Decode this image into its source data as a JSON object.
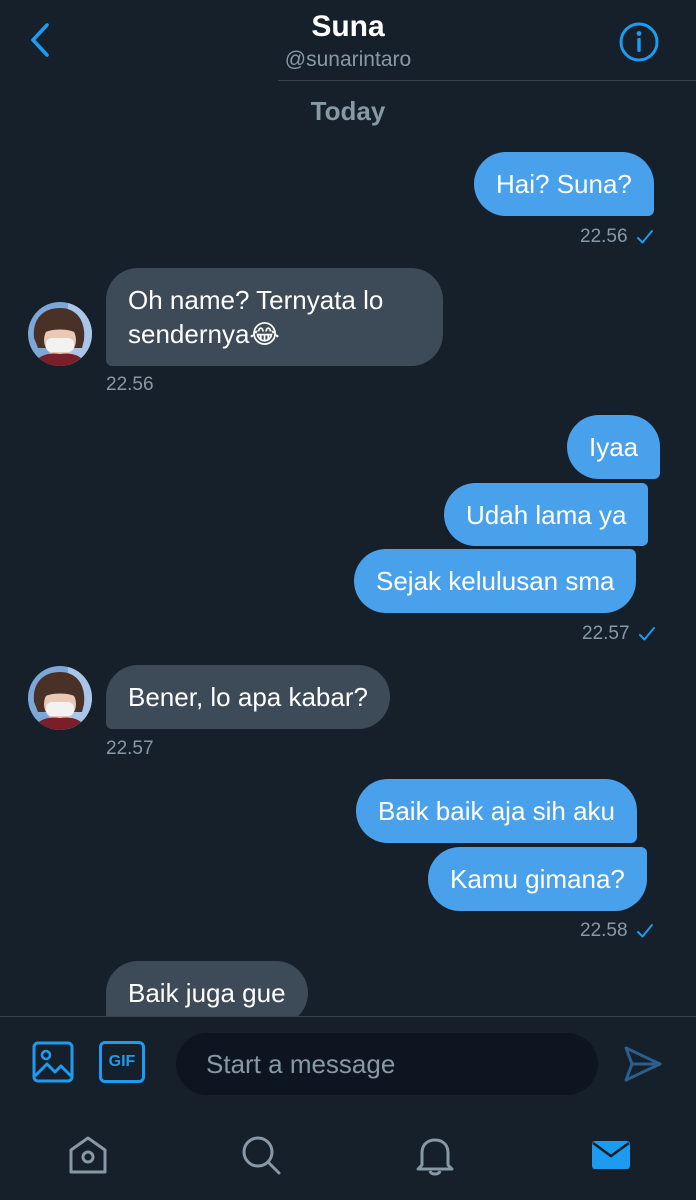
{
  "header": {
    "title": "Suna",
    "handle": "@sunarintaro",
    "back_icon": "chevron-left-icon",
    "info_icon": "info-icon"
  },
  "conversation": {
    "date_label": "Today",
    "messages": [
      {
        "direction": "out",
        "text": "Hai? Suna?"
      },
      {
        "direction": "out_time",
        "text": "22.56"
      },
      {
        "direction": "in",
        "text": "Oh name? Ternyata lo sendernya😂"
      },
      {
        "direction": "in_time",
        "text": "22.56"
      },
      {
        "direction": "out",
        "text": "Iyaa"
      },
      {
        "direction": "out",
        "text": "Udah lama ya"
      },
      {
        "direction": "out",
        "text": "Sejak kelulusan sma"
      },
      {
        "direction": "out_time",
        "text": "22.57"
      },
      {
        "direction": "in",
        "text": "Bener, lo apa kabar?"
      },
      {
        "direction": "in_time",
        "text": "22.57"
      },
      {
        "direction": "out",
        "text": "Baik baik aja sih aku"
      },
      {
        "direction": "out",
        "text": "Kamu gimana?"
      },
      {
        "direction": "out_time",
        "text": "22.58"
      },
      {
        "direction": "in",
        "text": "Baik juga gue"
      }
    ]
  },
  "composer": {
    "placeholder": "Start a message",
    "image_icon": "image-icon",
    "gif_label": "GIF",
    "send_icon": "send-icon"
  },
  "tabbar": {
    "items": [
      "home-icon",
      "search-icon",
      "notifications-icon",
      "messages-icon"
    ],
    "active": "messages-icon"
  },
  "colors": {
    "background": "#15202b",
    "accent": "#1d9bf0",
    "outgoing_bubble": "#4aa1eb",
    "incoming_bubble": "#3d4a58",
    "muted_text": "#8899a6"
  }
}
